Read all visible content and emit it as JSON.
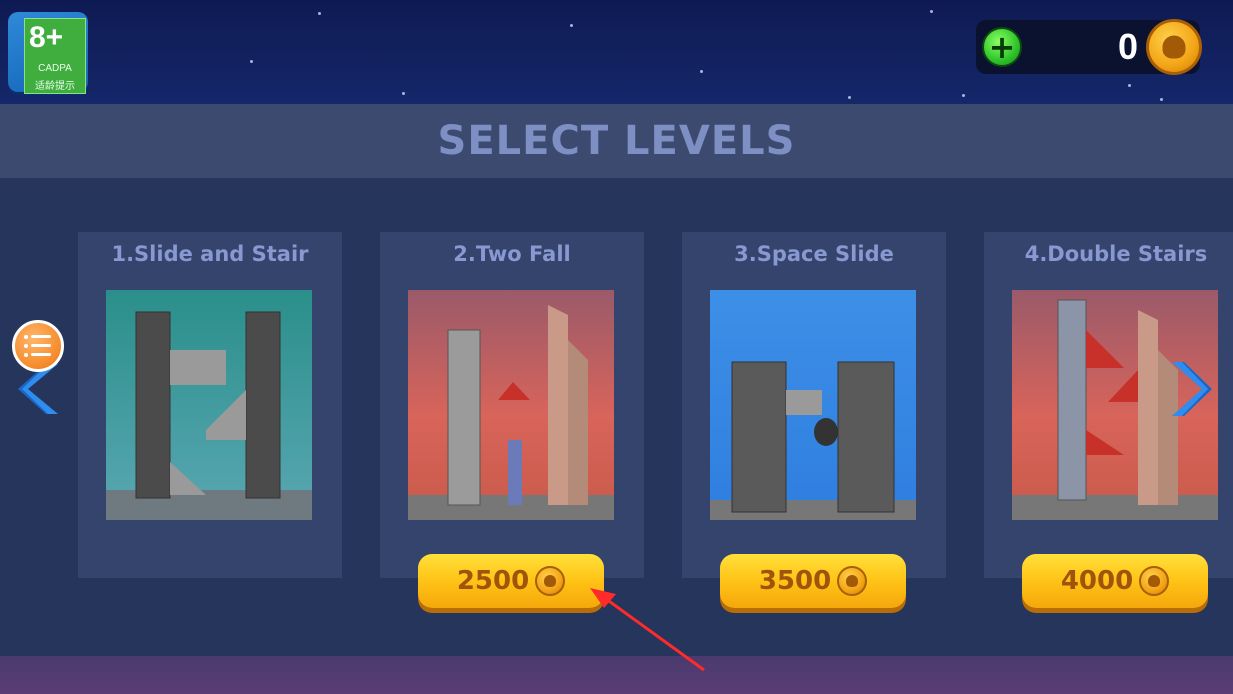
{
  "age_rating": {
    "label": "8+",
    "org": "CADPA",
    "note": "适龄提示"
  },
  "coins": {
    "value": "0",
    "add_icon": "plus-icon",
    "coin_icon": "coin-skull-icon"
  },
  "title": "SELECT LEVELS",
  "levels": [
    {
      "name": "1.Slide and Stair",
      "price": null,
      "theme": "teal"
    },
    {
      "name": "2.Two Fall",
      "price": "2500",
      "theme": "sunset"
    },
    {
      "name": "3.Space Slide",
      "price": "3500",
      "theme": "blue"
    },
    {
      "name": "4.Double Stairs",
      "price": "4000",
      "theme": "sunset"
    }
  ],
  "nav": {
    "left_icon": "chevron-left-icon",
    "right_icon": "chevron-right-icon",
    "menu_icon": "list-menu-icon"
  },
  "colors": {
    "accent": "#ffc316",
    "title": "#7e8fc4",
    "card": "#35446c",
    "annotation": "#ff2a2a"
  }
}
